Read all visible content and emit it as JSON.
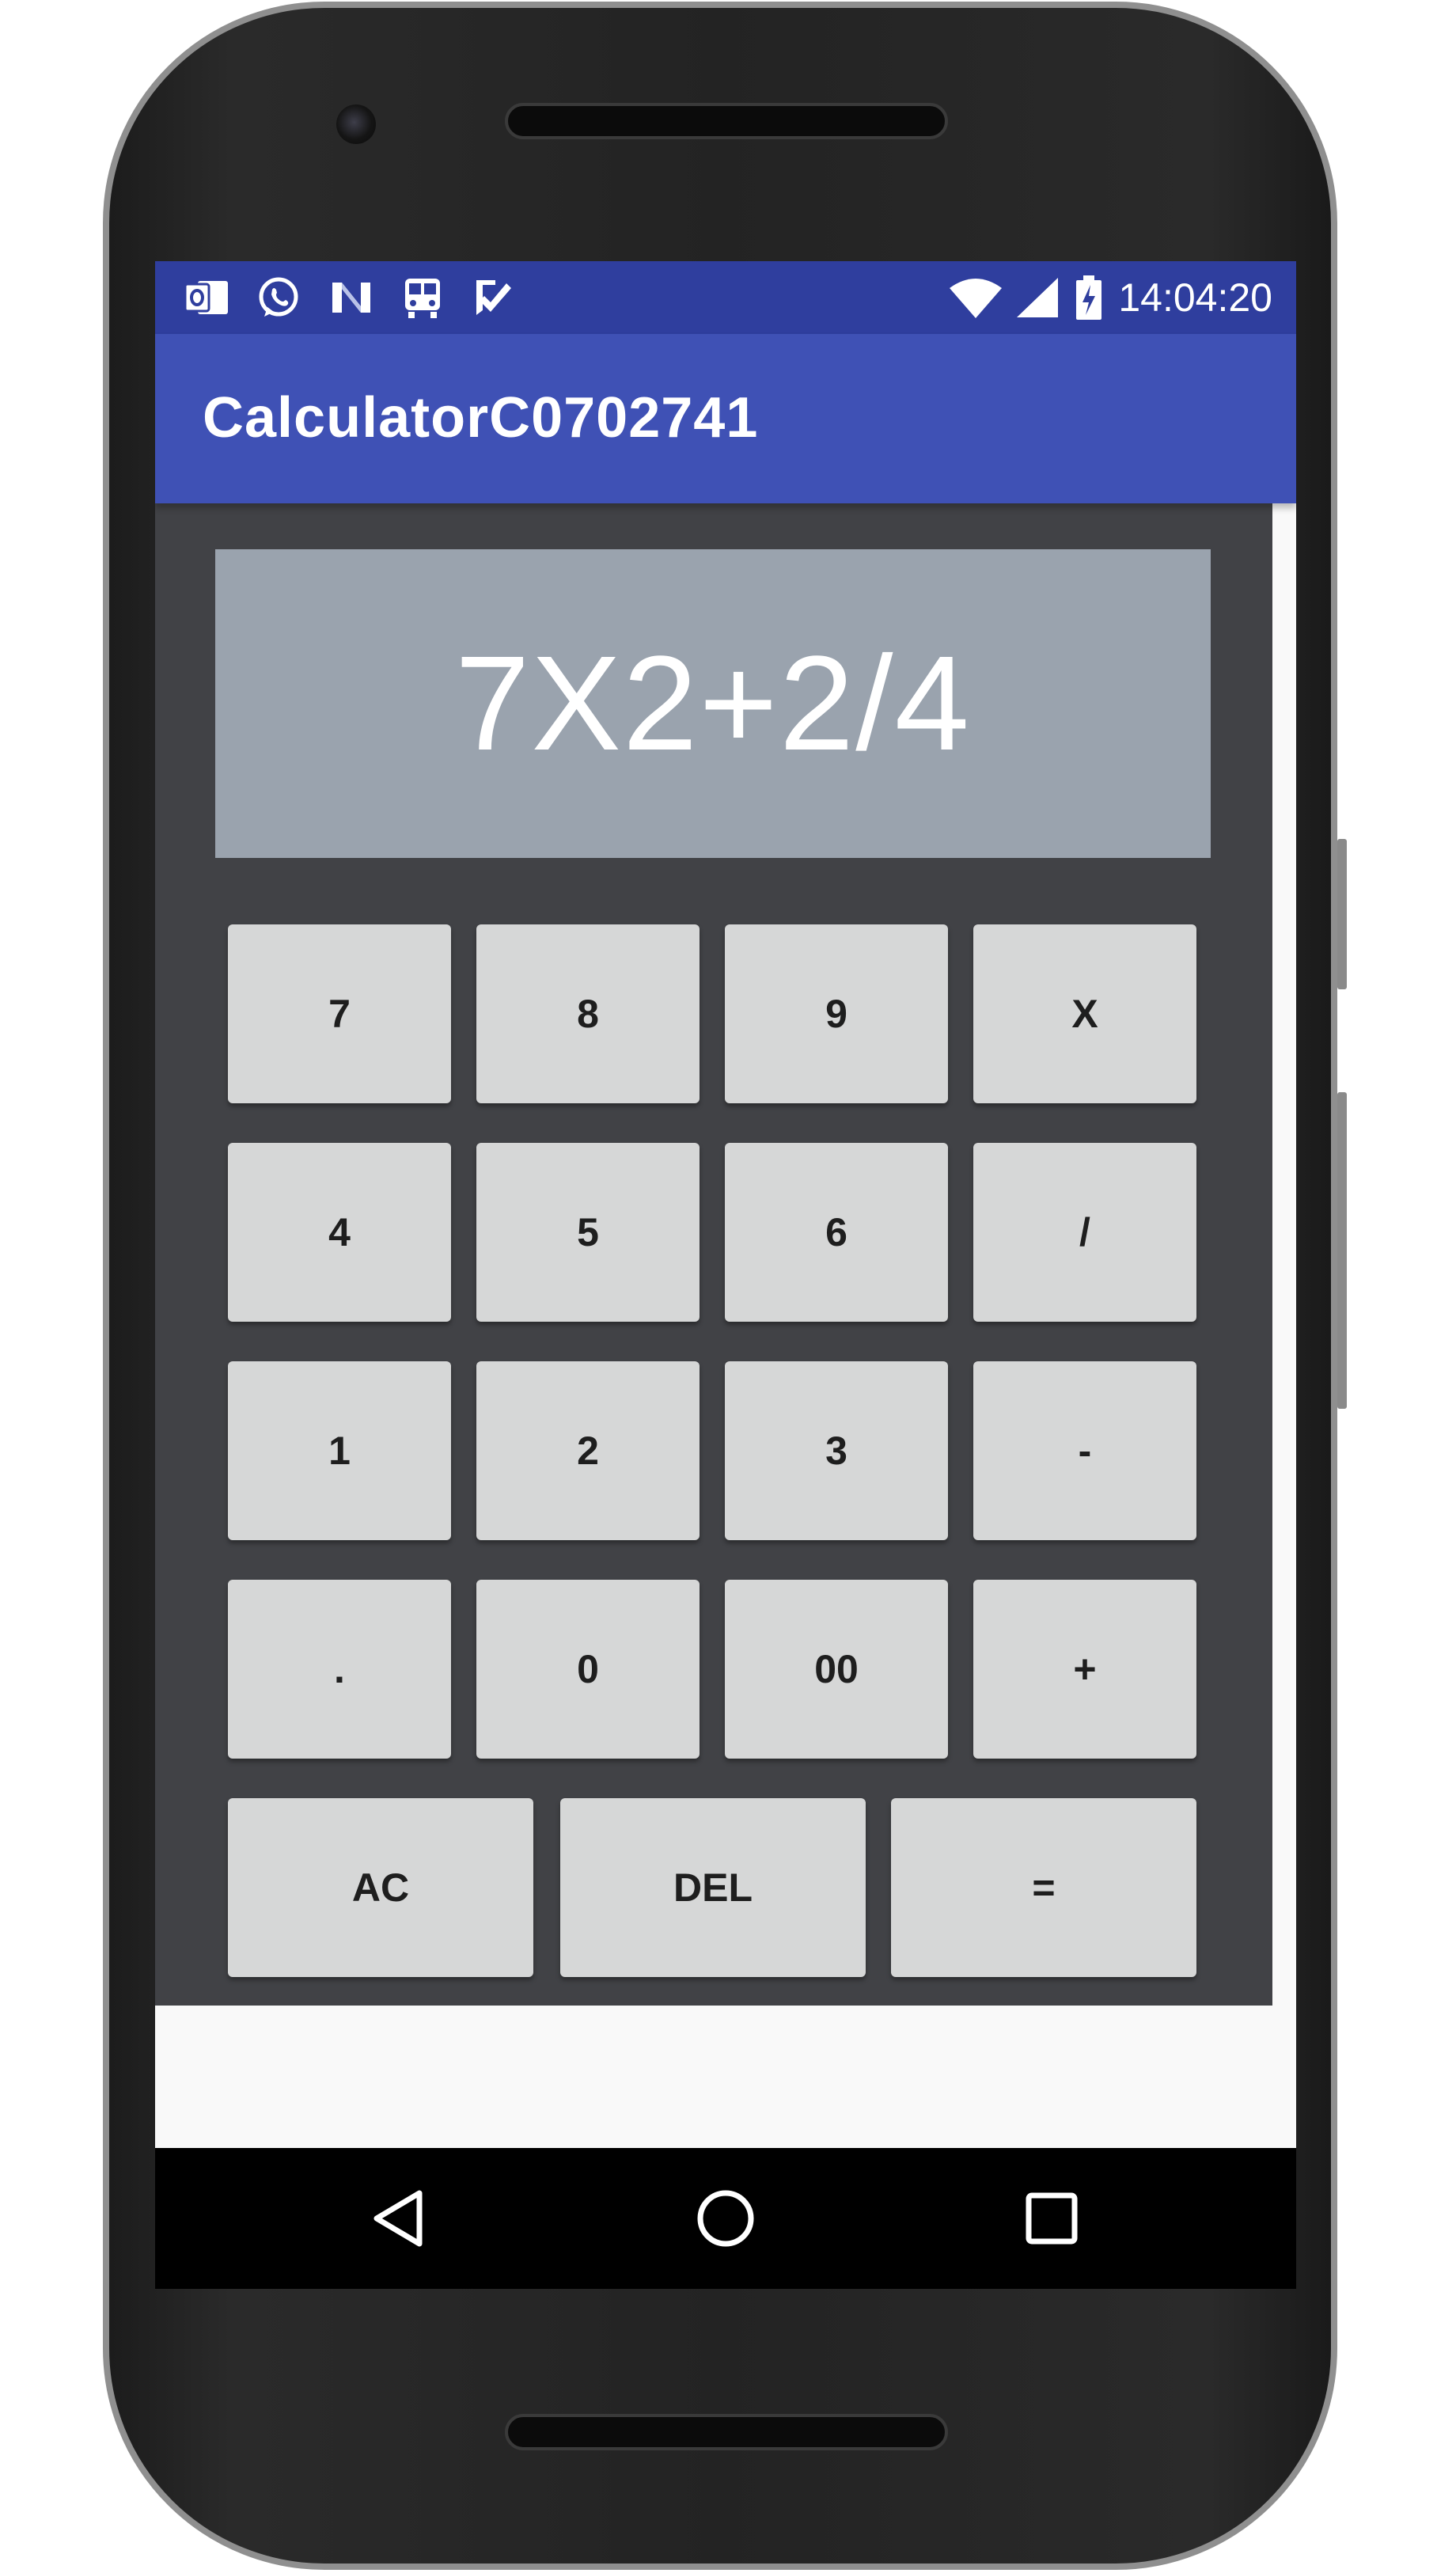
{
  "status_bar": {
    "time": "14:04:20",
    "left_icons": [
      "outlook-icon",
      "whatsapp-icon",
      "n-app-icon",
      "train-icon",
      "checkmark-app-icon"
    ],
    "right_icons": [
      "wifi-icon",
      "signal-icon",
      "battery-charging-icon"
    ]
  },
  "app_bar": {
    "title": "CalculatorC0702741"
  },
  "display": {
    "expression": "7X2+2/4"
  },
  "keypad": {
    "rows": [
      [
        "7",
        "8",
        "9",
        "X"
      ],
      [
        "4",
        "5",
        "6",
        "/"
      ],
      [
        "1",
        "2",
        "3",
        "-"
      ],
      [
        ".",
        "0",
        "00",
        "+"
      ],
      [
        "AC",
        "DEL",
        "="
      ]
    ]
  },
  "nav_bar": {
    "buttons": [
      "back-icon",
      "home-icon",
      "recents-icon"
    ]
  },
  "colors": {
    "status_bar": "#2f3e9e",
    "app_bar": "#3f51b5",
    "panel": "#414246",
    "display": "#9aa3ae",
    "key": "#d6d7d7"
  }
}
